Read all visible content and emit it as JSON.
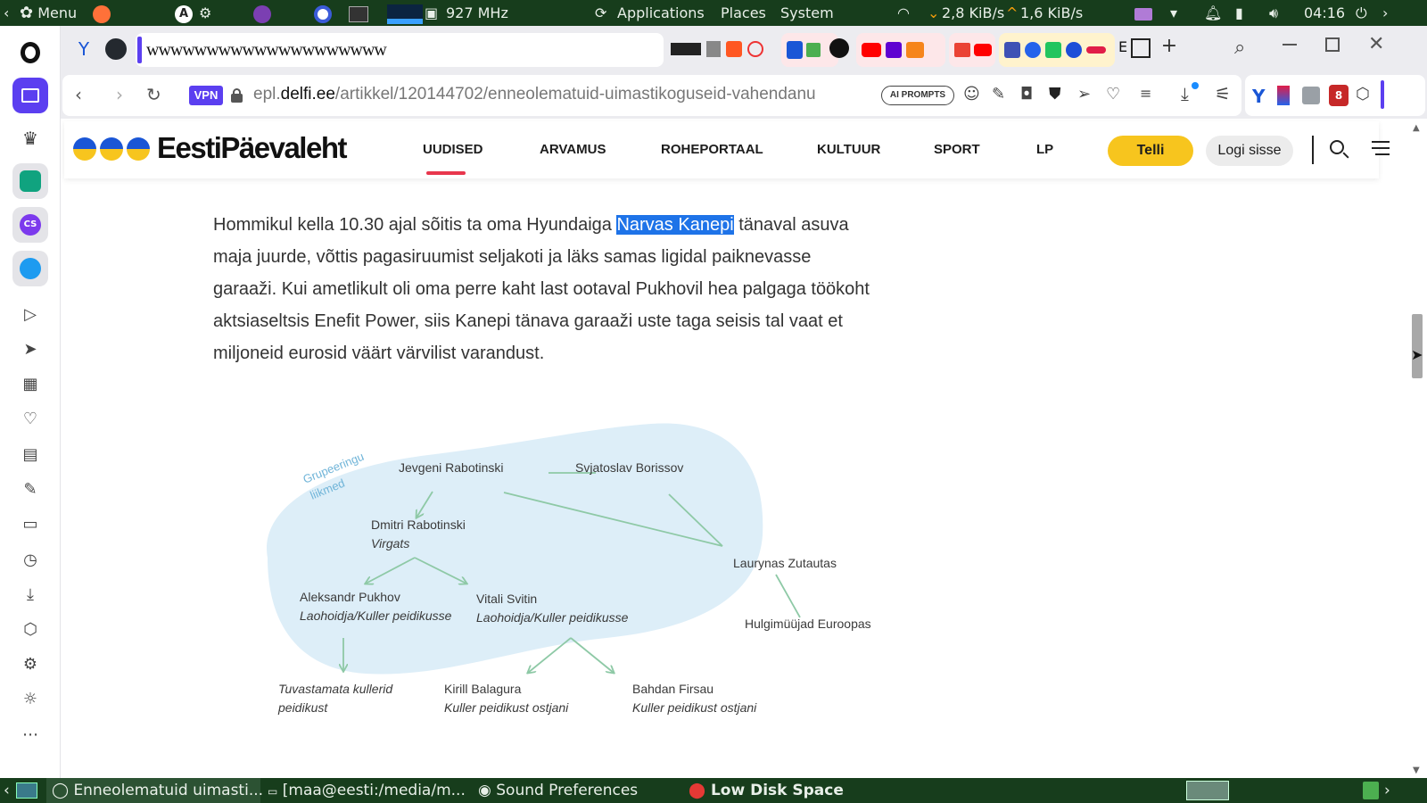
{
  "system_panel": {
    "menu_label": "Menu",
    "cpu_freq": "927 MHz",
    "applications": "Applications",
    "places": "Places",
    "system": "System",
    "net_down": "2,8 KiB/s",
    "net_up": "1,6 KiB/s",
    "clock": "04:16"
  },
  "browser": {
    "tab_title_text": "wwwwwwwwwwwwwwwwwwww",
    "tab_partial_label": "E",
    "vpn_label": "VPN",
    "url_domain_prefix": "epl.",
    "url_domain": "delfi.ee",
    "url_path": "/artikkel/120144702/enneolematuid-uimastikoguseid-vahendanu",
    "ai_prompts_label": "AI PROMPTS",
    "ext_badge_count": "8"
  },
  "site": {
    "logo_text": "EestiPäevaleht",
    "nav": [
      {
        "label": "UUDISED",
        "active": true
      },
      {
        "label": "ARVAMUS"
      },
      {
        "label": "ROHEPORTAAL"
      },
      {
        "label": "KULTUUR"
      },
      {
        "label": "SPORT"
      },
      {
        "label": "LP"
      }
    ],
    "subscribe_label": "Telli",
    "login_label": "Logi sisse",
    "accent_color": "#e8364d",
    "subscribe_color": "#f7c51e"
  },
  "article": {
    "para_before": "Hommikul kella 10.30 ajal sõitis ta oma Hyundaiga ",
    "para_selected": "Narvas Kanepi",
    "para_after": " tänaval asuva maja juurde, võttis pagasiruumist seljakoti ja läks samas ligidal paiknevasse garaaži. Kui ametlikult oli oma perre kaht last ootaval Pukhovil hea palgaga töökoht aktsiaseltsis Enefit Power, siis Kanepi tänava garaaži uste taga seisis tal vaat et miljoneid eurosid väärt värvilist varandust."
  },
  "diagram": {
    "group_label_1": "Grupeeringu",
    "group_label_2": "liikmed",
    "nodes": [
      {
        "name": "Jevgeni Rabotinski",
        "role": ""
      },
      {
        "name": "Svjatoslav Borissov",
        "role": ""
      },
      {
        "name": "Dmitri Rabotinski",
        "role": "Virgats"
      },
      {
        "name": "Laurynas Zutautas",
        "role": ""
      },
      {
        "name": "Aleksandr Pukhov",
        "role": "Laohoidja/Kuller peidikusse"
      },
      {
        "name": "Vitali Svitin",
        "role": "Laohoidja/Kuller peidikusse"
      },
      {
        "name": "Hulgimüüjad Euroopas",
        "role": ""
      },
      {
        "name": "",
        "role": "Tuvastamata kullerid"
      },
      {
        "name": "",
        "role": "peidikust"
      },
      {
        "name": "Kirill Balagura",
        "role": "Kuller peidikust ostjani"
      },
      {
        "name": "Bahdan Firsau",
        "role": "Kuller peidikust ostjani"
      }
    ],
    "group_fill": "#ddeef8",
    "arrow_color": "#8ec9a6"
  },
  "taskbar": {
    "items": [
      {
        "label": "Enneolematuid uimasti..."
      },
      {
        "label": "[maa@eesti:/media/m..."
      },
      {
        "label": "Sound Preferences"
      },
      {
        "label": "Low Disk Space"
      }
    ]
  }
}
